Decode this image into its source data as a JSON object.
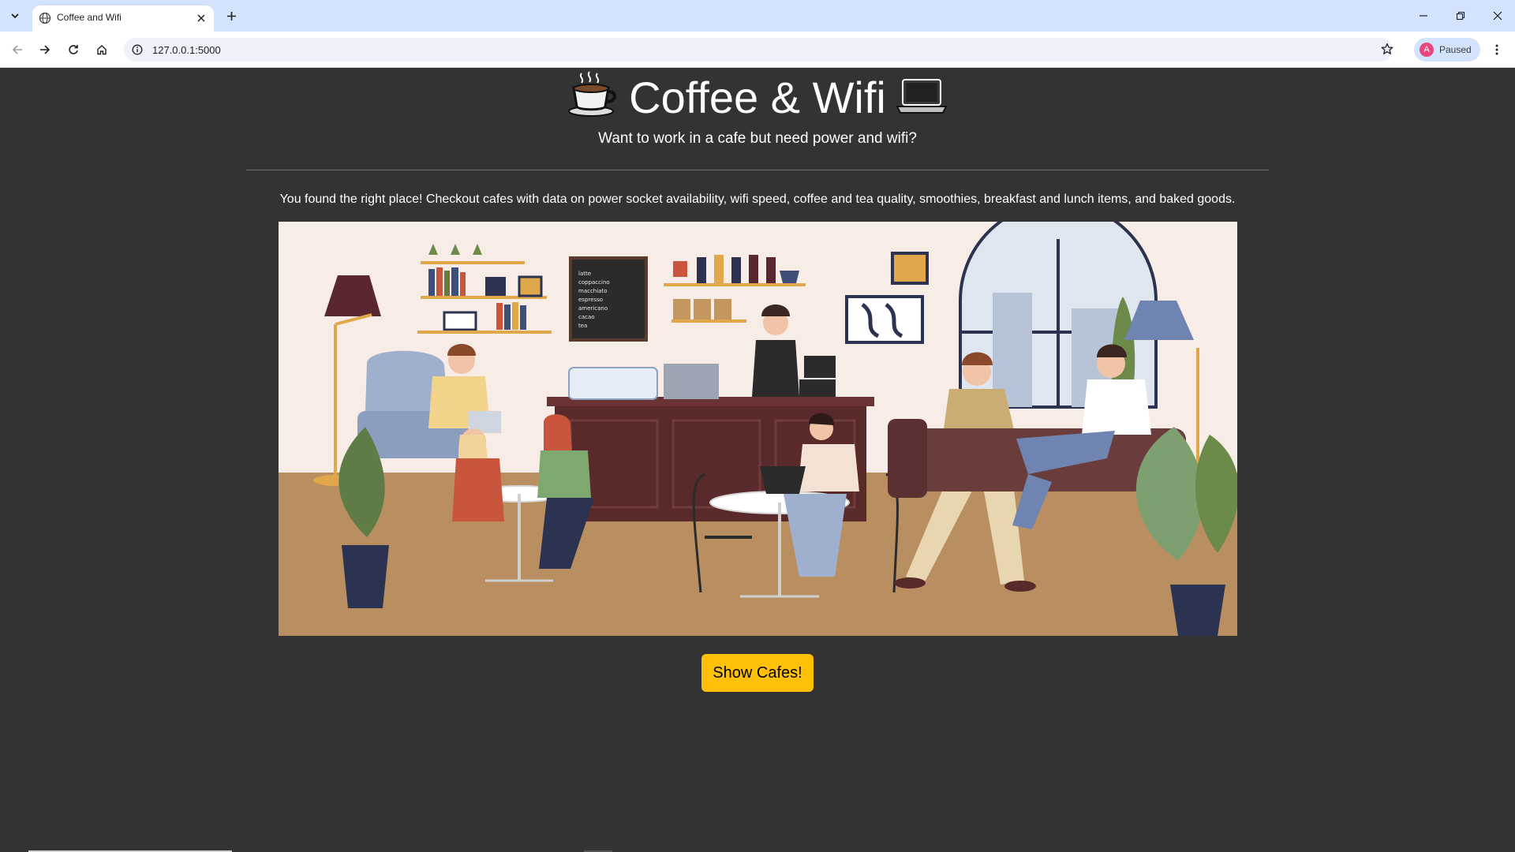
{
  "browser": {
    "tab_title": "Coffee and Wifi",
    "url": "127.0.0.1:5000",
    "profile_initial": "A",
    "profile_status": "Paused"
  },
  "page": {
    "title": "Coffee & Wifi",
    "title_left_emoji": "☕",
    "title_right_emoji": "💻",
    "subtitle": "Want to work in a cafe but need power and wifi?",
    "lead": "You found the right place! Checkout cafes with data on power socket availability, wifi speed, coffee and tea quality, smoothies, breakfast and lunch items, and baked goods.",
    "cta_label": "Show Cafes!"
  },
  "menu_board": {
    "items": [
      "latte",
      "coppaccino",
      "macchiato",
      "espresso",
      "americano",
      "cacao",
      "tea"
    ]
  },
  "colors": {
    "page_bg": "#333333",
    "accent": "#ffc107",
    "tabbar_bg": "#d3e3fd"
  }
}
